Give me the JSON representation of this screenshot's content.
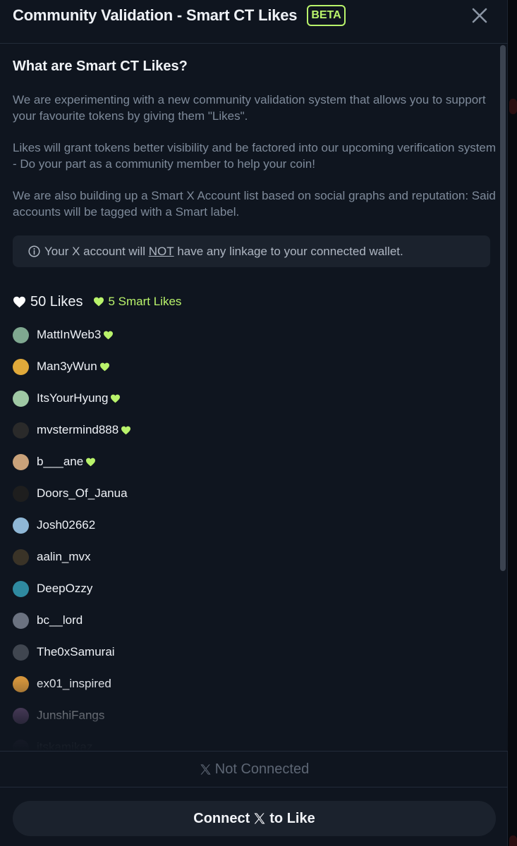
{
  "header": {
    "title": "Community Validation - Smart CT Likes",
    "badge": "BETA",
    "close_icon": "close-icon"
  },
  "info": {
    "heading": "What are Smart CT Likes?",
    "paragraphs": [
      "We are experimenting with a new community validation system that allows you to support your favourite tokens by giving them \"Likes\".",
      "Likes will grant tokens better visibility and be factored into our upcoming verification system - Do your part as a community member to help your coin!",
      "We are also building up a Smart X Account list based on social graphs and reputation: Said accounts will be tagged with a Smart label."
    ],
    "notice_prefix": "Your X account will ",
    "notice_emphasis": "NOT",
    "notice_suffix": " have any linkage to your connected wallet."
  },
  "likes": {
    "count_label": "50 Likes",
    "smart_label": "5 Smart Likes"
  },
  "users": [
    {
      "name": "MattInWeb3",
      "smart": true,
      "avatar_color": "#7fa890"
    },
    {
      "name": "Man3yWun",
      "smart": true,
      "avatar_color": "#e0a93a"
    },
    {
      "name": "ItsYourHyung",
      "smart": true,
      "avatar_color": "#9fc8a4"
    },
    {
      "name": "mvstermind888",
      "smart": true,
      "avatar_color": "#2a2a2a"
    },
    {
      "name": "b___ane",
      "smart": true,
      "avatar_color": "#c9a27a"
    },
    {
      "name": "Doors_Of_Janua",
      "smart": false,
      "avatar_color": "#1e1e1e"
    },
    {
      "name": "Josh02662",
      "smart": false,
      "avatar_color": "#8fb7d6"
    },
    {
      "name": "aalin_mvx",
      "smart": false,
      "avatar_color": "#3a3327"
    },
    {
      "name": "DeepOzzy",
      "smart": false,
      "avatar_color": "#2f8aa0"
    },
    {
      "name": "bc__lord",
      "smart": false,
      "avatar_color": "#6b7280"
    },
    {
      "name": "The0xSamurai",
      "smart": false,
      "avatar_color": "#404650"
    },
    {
      "name": "ex01_inspired",
      "smart": false,
      "avatar_color": "#d4953c"
    },
    {
      "name": "JunshiFangs",
      "smart": false,
      "avatar_color": "#7a5b8a"
    },
    {
      "name": "itskamikaz",
      "smart": false,
      "avatar_color": "#5a4a6a"
    }
  ],
  "footer": {
    "status": "Not Connected",
    "button_prefix": "Connect",
    "button_suffix": "to Like"
  },
  "colors": {
    "accent_green": "#b9f36b",
    "background": "#0f151f",
    "muted_text": "#7e8a9a"
  }
}
